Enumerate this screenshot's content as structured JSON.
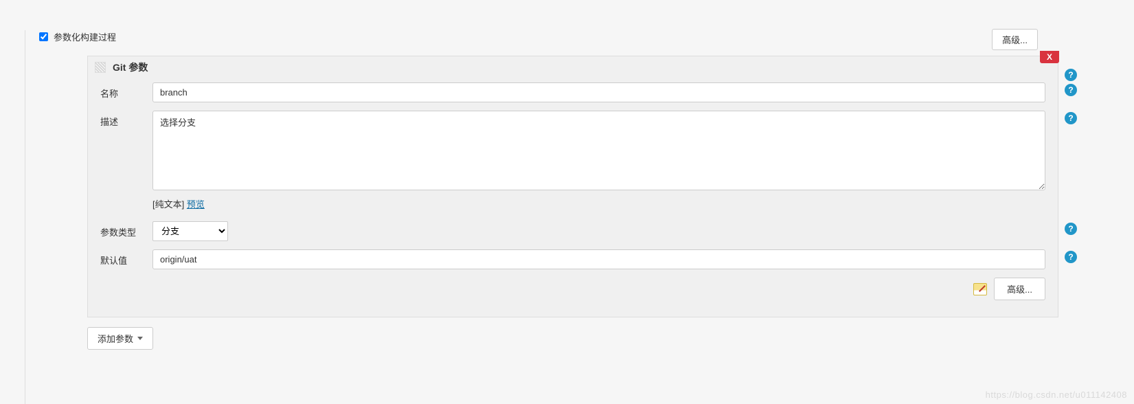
{
  "top": {
    "advanced_label": "高级..."
  },
  "checkbox": {
    "label": "参数化构建过程",
    "checked": true
  },
  "param_section": {
    "title": "Git 参数",
    "close_glyph": "X",
    "fields": {
      "name": {
        "label": "名称",
        "value": "branch"
      },
      "description": {
        "label": "描述",
        "value": "选择分支",
        "format_prefix": "[纯文本] ",
        "preview_link": "预览"
      },
      "param_type": {
        "label": "参数类型",
        "selected": "分支"
      },
      "default_value": {
        "label": "默认值",
        "value": "origin/uat"
      }
    },
    "advanced_label": "高级..."
  },
  "add_param_label": "添加参数",
  "help_glyph": "?",
  "watermark": "https://blog.csdn.net/u011142408"
}
